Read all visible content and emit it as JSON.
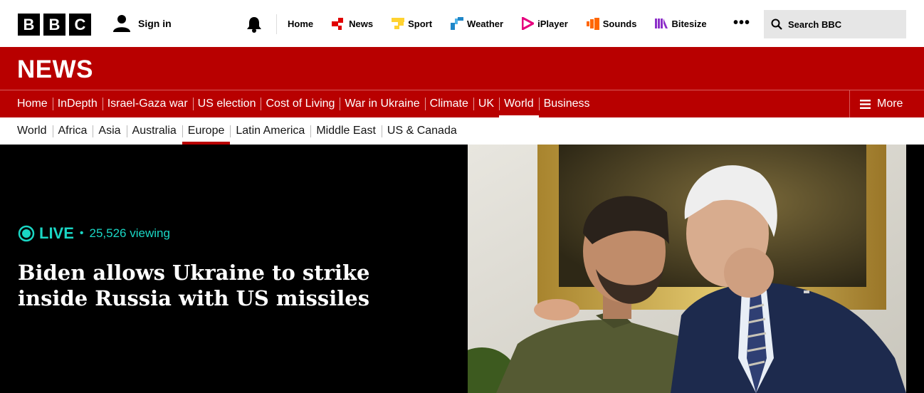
{
  "header": {
    "logo_letters": [
      "B",
      "B",
      "C"
    ],
    "sign_in": "Sign in",
    "nav": [
      {
        "label": "Home",
        "icon": "none"
      },
      {
        "label": "News",
        "icon": "news-icon",
        "color": "#e00000"
      },
      {
        "label": "Sport",
        "icon": "sport-icon",
        "color": "#ffd230"
      },
      {
        "label": "Weather",
        "icon": "weather-icon",
        "color": "#1f86c8"
      },
      {
        "label": "iPlayer",
        "icon": "iplayer-icon",
        "color": "#e6007e"
      },
      {
        "label": "Sounds",
        "icon": "sounds-icon",
        "color": "#ff6600"
      },
      {
        "label": "Bitesize",
        "icon": "bitesize-icon",
        "color": "#8d2fc9"
      }
    ],
    "more_dots": "•••",
    "search_label": "Search BBC"
  },
  "news_banner": {
    "title": "NEWS"
  },
  "main_nav": {
    "items": [
      "Home",
      "InDepth",
      "Israel-Gaza war",
      "US election",
      "Cost of Living",
      "War in Ukraine",
      "Climate",
      "UK",
      "World",
      "Business"
    ],
    "active": "World",
    "more_label": "More"
  },
  "sub_nav": {
    "items": [
      "World",
      "Africa",
      "Asia",
      "Australia",
      "Europe",
      "Latin America",
      "Middle East",
      "US & Canada"
    ],
    "active": "Europe"
  },
  "hero": {
    "live_label": "LIVE",
    "viewing": "25,526 viewing",
    "headline": "Biden allows Ukraine to strike inside Russia with US missiles"
  },
  "colors": {
    "brand_red": "#b80000",
    "live_teal": "#1ad6c4"
  }
}
